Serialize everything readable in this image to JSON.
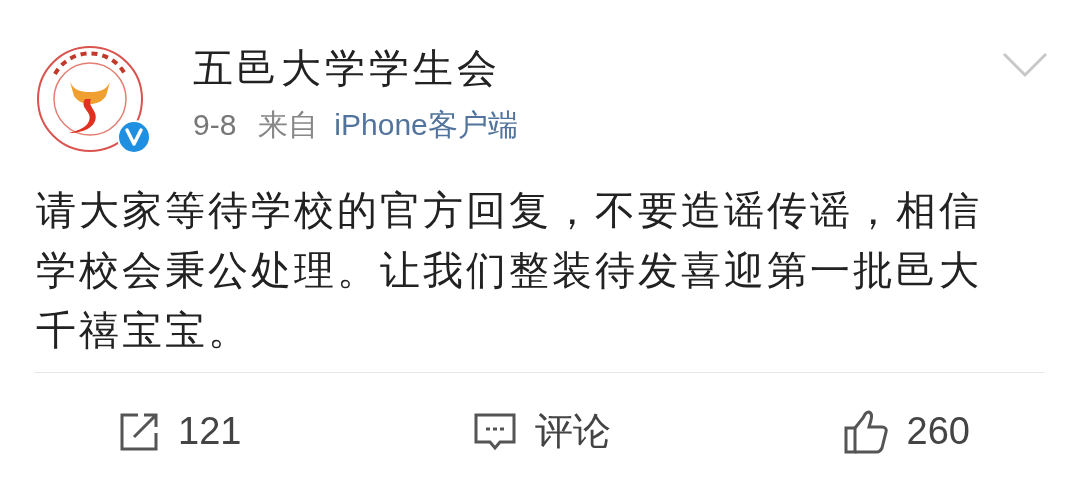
{
  "post": {
    "author": "五邑大学学生会",
    "verified": true,
    "date": "9-8",
    "source_prefix": "来自",
    "source": "iPhone客户端",
    "text": "请大家等待学校的官方回复，不要造谣传谣，相信学校会秉公处理。让我们整装待发喜迎第一批邑大千禧宝宝。"
  },
  "actions": [
    {
      "kind": "repost",
      "label": "121"
    },
    {
      "kind": "comment",
      "label": "评论"
    },
    {
      "kind": "like",
      "label": "260"
    }
  ]
}
